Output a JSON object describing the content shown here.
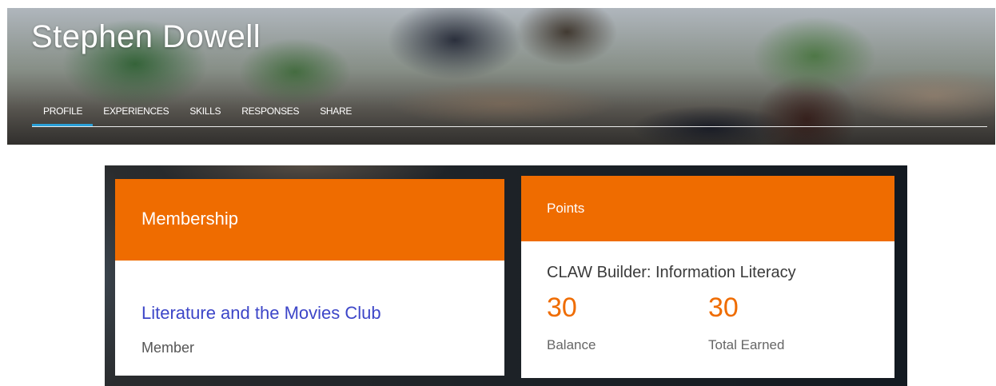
{
  "header": {
    "name": "Stephen Dowell",
    "tabs": [
      {
        "label": "PROFILE",
        "active": true
      },
      {
        "label": "EXPERIENCES",
        "active": false
      },
      {
        "label": "SKILLS",
        "active": false
      },
      {
        "label": "RESPONSES",
        "active": false
      },
      {
        "label": "SHARE",
        "active": false
      }
    ]
  },
  "membership": {
    "title": "Membership",
    "club": "Literature and the Movies Club",
    "role": "Member"
  },
  "points": {
    "title": "Points",
    "program": "CLAW Builder: Information Literacy",
    "balance": {
      "value": "30",
      "label": "Balance"
    },
    "total_earned": {
      "value": "30",
      "label": "Total Earned"
    }
  },
  "colors": {
    "accent": "#ef6c00",
    "link": "#3d46c8",
    "active_tab_underline": "#2aa0d8"
  }
}
